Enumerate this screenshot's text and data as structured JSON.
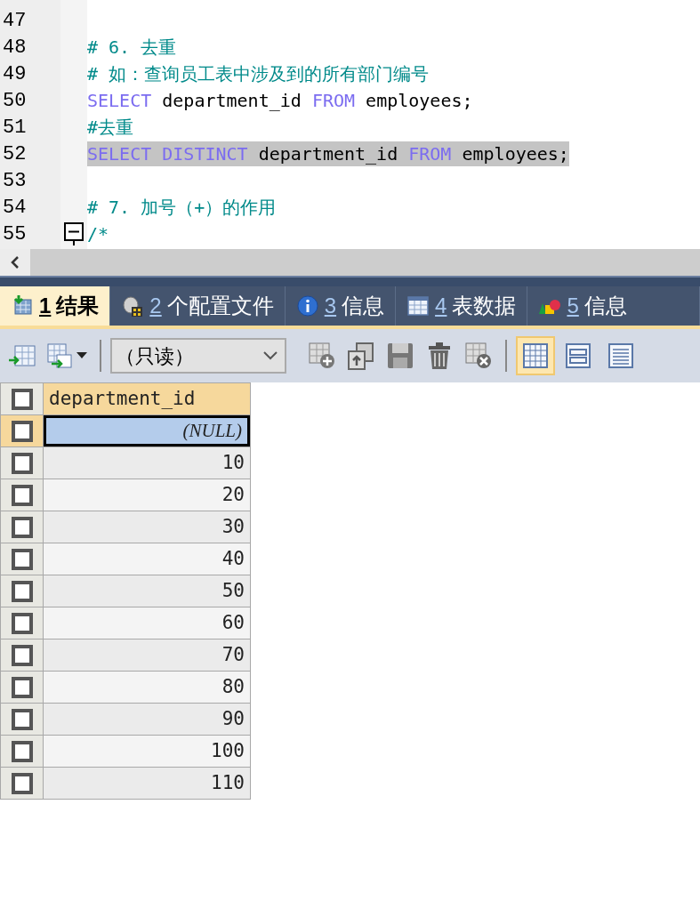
{
  "editor": {
    "lines": [
      {
        "number": "47"
      },
      {
        "number": "48",
        "tokens": [
          {
            "kind": "comment",
            "text": "# 6. 去重"
          }
        ]
      },
      {
        "number": "49",
        "tokens": [
          {
            "kind": "comment",
            "text": "# 如：查询员工表中涉及到的所有部门编号"
          }
        ]
      },
      {
        "number": "50",
        "tokens": [
          {
            "kind": "keyword",
            "text": "SELECT"
          },
          {
            "kind": "plain",
            "text": " department_id "
          },
          {
            "kind": "keyword",
            "text": "FROM"
          },
          {
            "kind": "plain",
            "text": " employees;"
          }
        ]
      },
      {
        "number": "51",
        "tokens": [
          {
            "kind": "comment",
            "text": "#去重"
          }
        ]
      },
      {
        "number": "52",
        "highlighted": true,
        "tokens": [
          {
            "kind": "keyword",
            "text": "SELECT DISTINCT"
          },
          {
            "kind": "plain",
            "text": " department_id "
          },
          {
            "kind": "keyword",
            "text": "FROM"
          },
          {
            "kind": "plain",
            "text": " employees;"
          }
        ]
      },
      {
        "number": "53"
      },
      {
        "number": "54",
        "tokens": [
          {
            "kind": "comment",
            "text": "# 7. 加号（+）的作用"
          }
        ]
      },
      {
        "number": "55",
        "expanded": true,
        "tokens": [
          {
            "kind": "comment",
            "text": "/*"
          }
        ]
      }
    ]
  },
  "tabs": [
    {
      "number": "1",
      "label": "结果",
      "selected": true
    },
    {
      "number": "2",
      "label": "个配置文件",
      "selected": false
    },
    {
      "number": "3",
      "label": "信息",
      "selected": false
    },
    {
      "number": "4",
      "label": "表数据",
      "selected": false
    },
    {
      "number": "5",
      "label": "信息",
      "selected": false
    }
  ],
  "toolbar": {
    "mode": "（只读）",
    "views": [
      {
        "selected": true
      },
      {
        "selected": false
      },
      {
        "selected": false
      }
    ]
  },
  "grid": {
    "column": "department_id",
    "header_checked": false,
    "rows": [
      {
        "kind": "null",
        "value": "(NULL)",
        "selected": true,
        "checked": false
      },
      {
        "kind": "value",
        "value": "10",
        "selected": false,
        "checked": false
      },
      {
        "kind": "value",
        "value": "20",
        "selected": false,
        "checked": false
      },
      {
        "kind": "value",
        "value": "30",
        "selected": false,
        "checked": false
      },
      {
        "kind": "value",
        "value": "40",
        "selected": false,
        "checked": false
      },
      {
        "kind": "value",
        "value": "50",
        "selected": false,
        "checked": false
      },
      {
        "kind": "value",
        "value": "60",
        "selected": false,
        "checked": false
      },
      {
        "kind": "value",
        "value": "70",
        "selected": false,
        "checked": false
      },
      {
        "kind": "value",
        "value": "80",
        "selected": false,
        "checked": false
      },
      {
        "kind": "value",
        "value": "90",
        "selected": false,
        "checked": false
      },
      {
        "kind": "value",
        "value": "100",
        "selected": false,
        "checked": false
      },
      {
        "kind": "value",
        "value": "110",
        "selected": false,
        "checked": false
      }
    ]
  }
}
